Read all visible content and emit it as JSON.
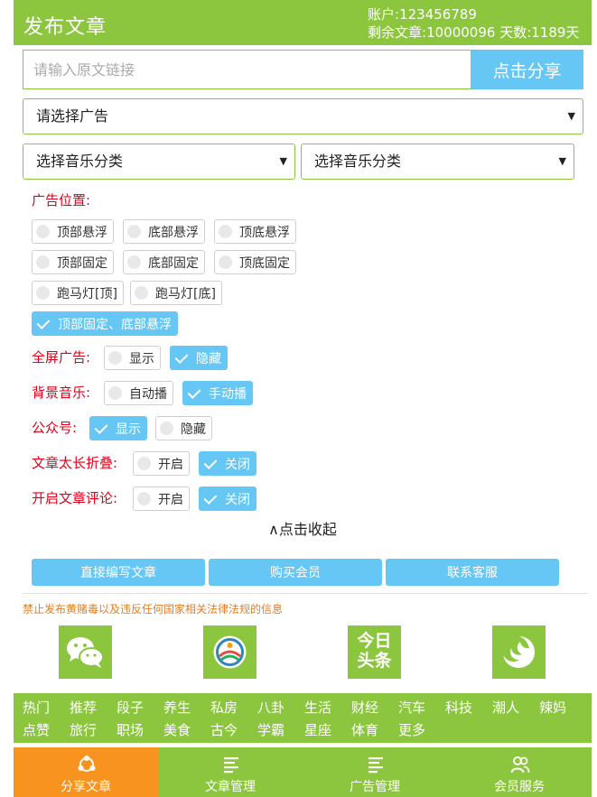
{
  "header": {
    "title": "发布文章",
    "account_label": "账户:",
    "account_value": "123456789",
    "remaining_label": "剩余文章:",
    "remaining_value": "10000096",
    "days_label": "天数:",
    "days_value": "1189",
    "days_unit": "天"
  },
  "share": {
    "placeholder": "请输入原文链接",
    "button": "点击分享"
  },
  "selects": {
    "ad": "请选择广告",
    "music1": "选择音乐分类",
    "music2": "选择音乐分类",
    "arrow": "▼"
  },
  "ad_position": {
    "label": "广告位置:",
    "options": [
      {
        "label": "顶部悬浮",
        "selected": false
      },
      {
        "label": "底部悬浮",
        "selected": false
      },
      {
        "label": "顶底悬浮",
        "selected": false
      },
      {
        "label": "顶部固定",
        "selected": false
      },
      {
        "label": "底部固定",
        "selected": false
      },
      {
        "label": "顶底固定",
        "selected": false
      },
      {
        "label": "跑马灯[顶]",
        "selected": false
      },
      {
        "label": "跑马灯[底]",
        "selected": false
      },
      {
        "label": "顶部固定、底部悬浮",
        "selected": true
      }
    ]
  },
  "fullscreen_ad": {
    "label": "全屏广告:",
    "options": [
      {
        "label": "显示",
        "selected": false
      },
      {
        "label": "隐藏",
        "selected": true
      }
    ]
  },
  "bg_music": {
    "label": "背景音乐:",
    "options": [
      {
        "label": "自动播",
        "selected": false
      },
      {
        "label": "手动播",
        "selected": true
      }
    ]
  },
  "public_account": {
    "label": "公众号:",
    "options": [
      {
        "label": "显示",
        "selected": true
      },
      {
        "label": "隐藏",
        "selected": false
      }
    ]
  },
  "fold_long": {
    "label": "文章太长折叠:",
    "options": [
      {
        "label": "开启",
        "selected": false
      },
      {
        "label": "关闭",
        "selected": true
      }
    ]
  },
  "comments": {
    "label": "开启文章评论:",
    "options": [
      {
        "label": "开启",
        "selected": false
      },
      {
        "label": "关闭",
        "selected": true
      }
    ]
  },
  "collapse_text": "∧点击收起",
  "actions": {
    "write": "直接编写文章",
    "buy": "购买会员",
    "contact": "联系客服"
  },
  "notice": "禁止发布黄赌毒以及违反任何国家相关法律法规的信息",
  "platforms": {
    "toutiao_line1": "今日",
    "toutiao_line2": "头条"
  },
  "categories": [
    "热门",
    "推荐",
    "段子",
    "养生",
    "私房",
    "八卦",
    "生活",
    "财经",
    "汽车",
    "科技",
    "潮人",
    "辣妈",
    "点赞",
    "旅行",
    "职场",
    "美食",
    "古今",
    "学霸",
    "星座",
    "体育",
    "更多"
  ],
  "tabs": {
    "share": "分享文章",
    "articles": "文章管理",
    "ads": "广告管理",
    "member": "会员服务"
  },
  "colors": {
    "green": "#8cc63f",
    "blue": "#66c7f4",
    "orange": "#f7931e",
    "red": "#e2001a"
  }
}
